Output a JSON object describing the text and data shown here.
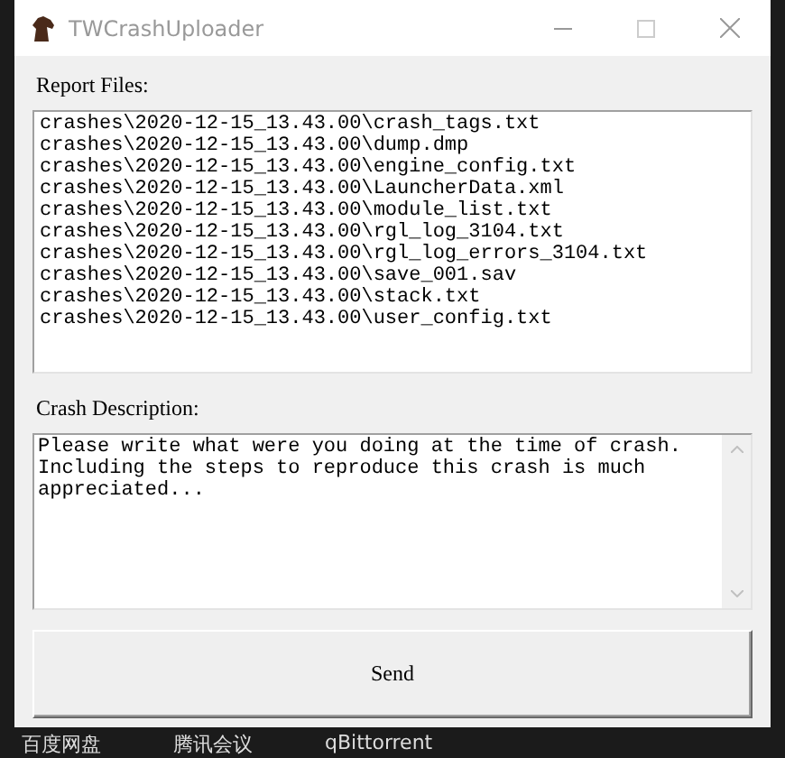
{
  "window": {
    "title": "TWCrashUploader"
  },
  "report_files": {
    "label": "Report Files:",
    "items": [
      "crashes\\2020-12-15_13.43.00\\crash_tags.txt",
      "crashes\\2020-12-15_13.43.00\\dump.dmp",
      "crashes\\2020-12-15_13.43.00\\engine_config.txt",
      "crashes\\2020-12-15_13.43.00\\LauncherData.xml",
      "crashes\\2020-12-15_13.43.00\\module_list.txt",
      "crashes\\2020-12-15_13.43.00\\rgl_log_3104.txt",
      "crashes\\2020-12-15_13.43.00\\rgl_log_errors_3104.txt",
      "crashes\\2020-12-15_13.43.00\\save_001.sav",
      "crashes\\2020-12-15_13.43.00\\stack.txt",
      "crashes\\2020-12-15_13.43.00\\user_config.txt"
    ]
  },
  "crash_description": {
    "label": "Crash Description:",
    "value": "Please write what were you doing at the time of crash.\nIncluding the steps to reproduce this crash is much\nappreciated..."
  },
  "buttons": [
    "Send"
  ],
  "desktop_labels": [
    "百度网盘",
    "腾讯会议",
    "qBittorrent"
  ]
}
